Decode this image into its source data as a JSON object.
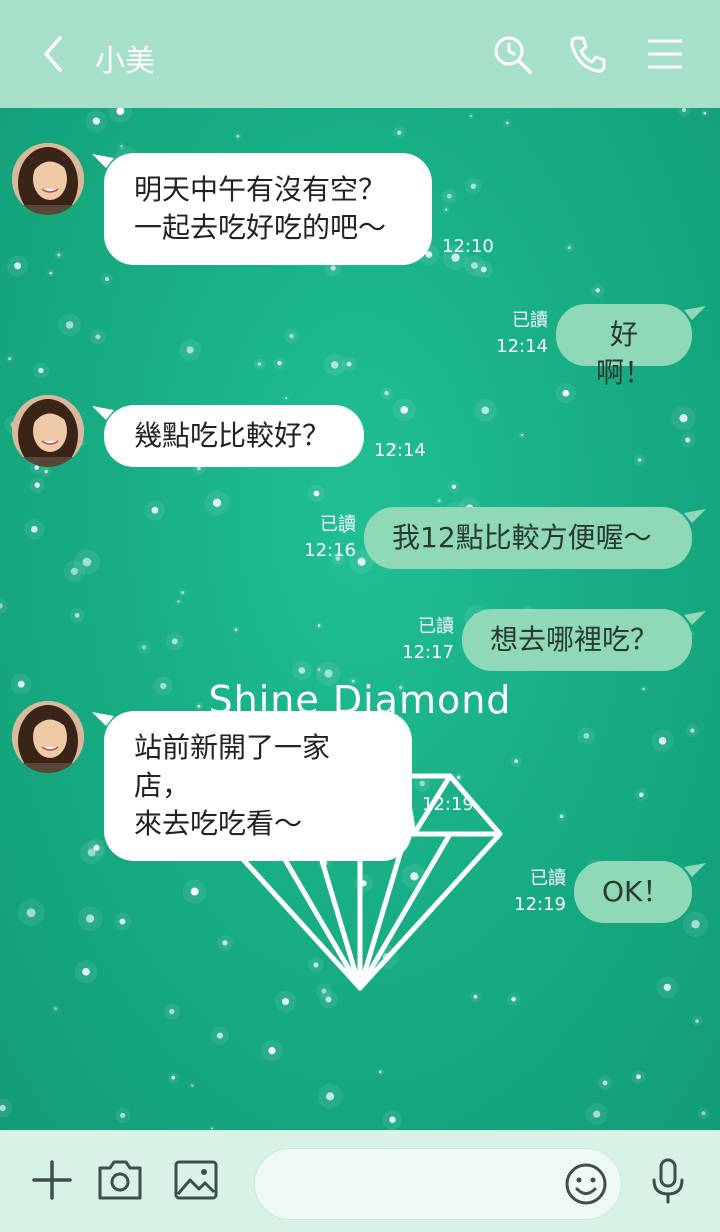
{
  "header": {
    "title": "小美",
    "icons": [
      "back-chevron-icon",
      "search-icon",
      "phone-icon",
      "menu-icon"
    ]
  },
  "theme": {
    "brand": "Shine Diamond",
    "accent": "#1aaf85",
    "header_bg": "#a6e0c8",
    "out_bubble": "#8fd9b9"
  },
  "messages": [
    {
      "side": "in",
      "lines": [
        "明天中午有沒有空？",
        "一起去吃好吃的吧～"
      ],
      "time": "12:10"
    },
    {
      "side": "out",
      "text": "好啊！",
      "read": "已讀",
      "time": "12:14"
    },
    {
      "side": "in",
      "lines": [
        "幾點吃比較好？"
      ],
      "time": "12:14"
    },
    {
      "side": "out",
      "text": "我12點比較方便喔～",
      "read": "已讀",
      "time": "12:16"
    },
    {
      "side": "out",
      "text": "想去哪裡吃？",
      "read": "已讀",
      "time": "12:17"
    },
    {
      "side": "in",
      "lines": [
        "站前新開了一家店，",
        "來去吃吃看～"
      ],
      "time": "12:19"
    },
    {
      "side": "out",
      "text": "OK！",
      "read": "已讀",
      "time": "12:19"
    }
  ],
  "footer": {
    "icons": [
      "plus-icon",
      "camera-icon",
      "image-icon",
      "emoji-icon",
      "microphone-icon"
    ],
    "input_placeholder": ""
  }
}
